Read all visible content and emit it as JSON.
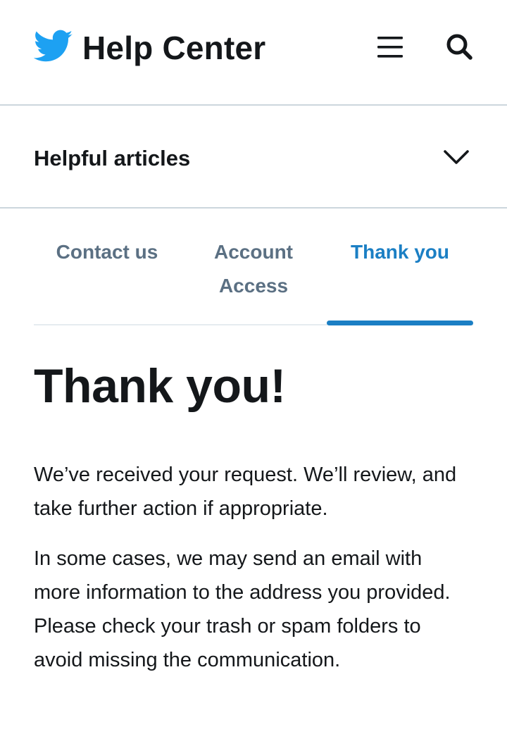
{
  "header": {
    "logo_icon": "twitter-bird-icon",
    "title": "Help Center",
    "menu_icon": "hamburger-menu-icon",
    "search_icon": "search-icon"
  },
  "helpful_articles": {
    "label": "Helpful articles",
    "icon": "chevron-down-icon"
  },
  "tabs": [
    {
      "label": "Contact us",
      "active": false
    },
    {
      "label": "Account Access",
      "active": false
    },
    {
      "label": "Thank you",
      "active": true
    }
  ],
  "main": {
    "title": "Thank you!",
    "paragraphs": [
      "We’ve received your request. We’ll review, and take further action if appropriate.",
      "In some cases, we may send an email with more information to the address you provided. Please check your trash or spam folders to avoid missing the communication."
    ]
  },
  "colors": {
    "brand": "#1da1f2",
    "active_tab": "#1b7fc4",
    "inactive_tab": "#5b7083",
    "text": "#14171a",
    "divider": "#ccd6dd"
  }
}
